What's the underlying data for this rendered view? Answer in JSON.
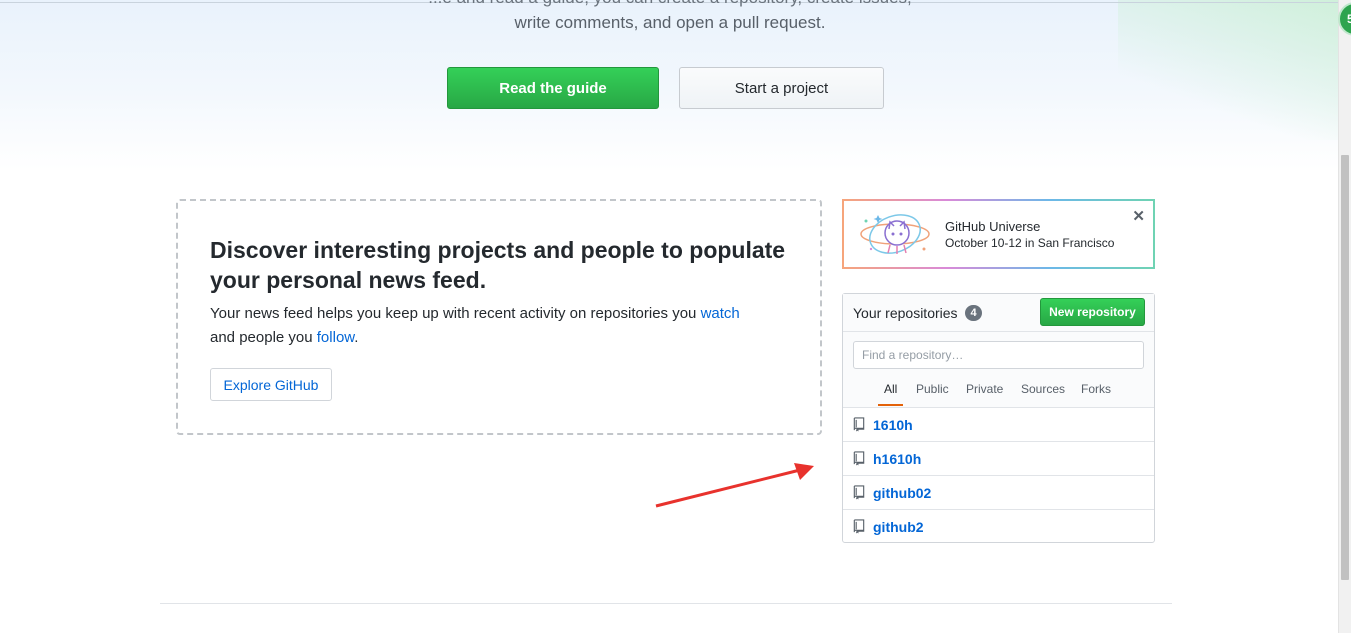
{
  "hero": {
    "clipped_line": "...e and read a guide, you can create a repository, create issues,",
    "description": "write comments, and open a pull request.",
    "primary_button": "Read the guide",
    "secondary_button": "Start a project"
  },
  "discover": {
    "title": "Discover interesting projects and people to populate your personal news feed.",
    "text_before_watch": "Your news feed helps you keep up with recent activity on repositories you ",
    "watch_link": "watch",
    "text_middle": " and people you ",
    "follow_link": "follow",
    "text_end": ".",
    "explore_button": "Explore GitHub"
  },
  "universe": {
    "title": "GitHub Universe",
    "subtitle": "October 10-12 in San Francisco",
    "close": "✕",
    "logo_icon": "octocat-universe-icon"
  },
  "repositories": {
    "title": "Your repositories",
    "count": "4",
    "new_button": "New repository",
    "search_placeholder": "Find a repository…",
    "filters": [
      "All",
      "Public",
      "Private",
      "Sources",
      "Forks"
    ],
    "active_filter": "All",
    "items": [
      "1610h",
      "h1610h",
      "github02",
      "github2"
    ]
  },
  "extension_badge": "5",
  "colors": {
    "accent_green": "#28a745",
    "link_blue": "#0366d6",
    "annotation_arrow": "#e8322d",
    "active_tab_underline": "#e36209"
  }
}
